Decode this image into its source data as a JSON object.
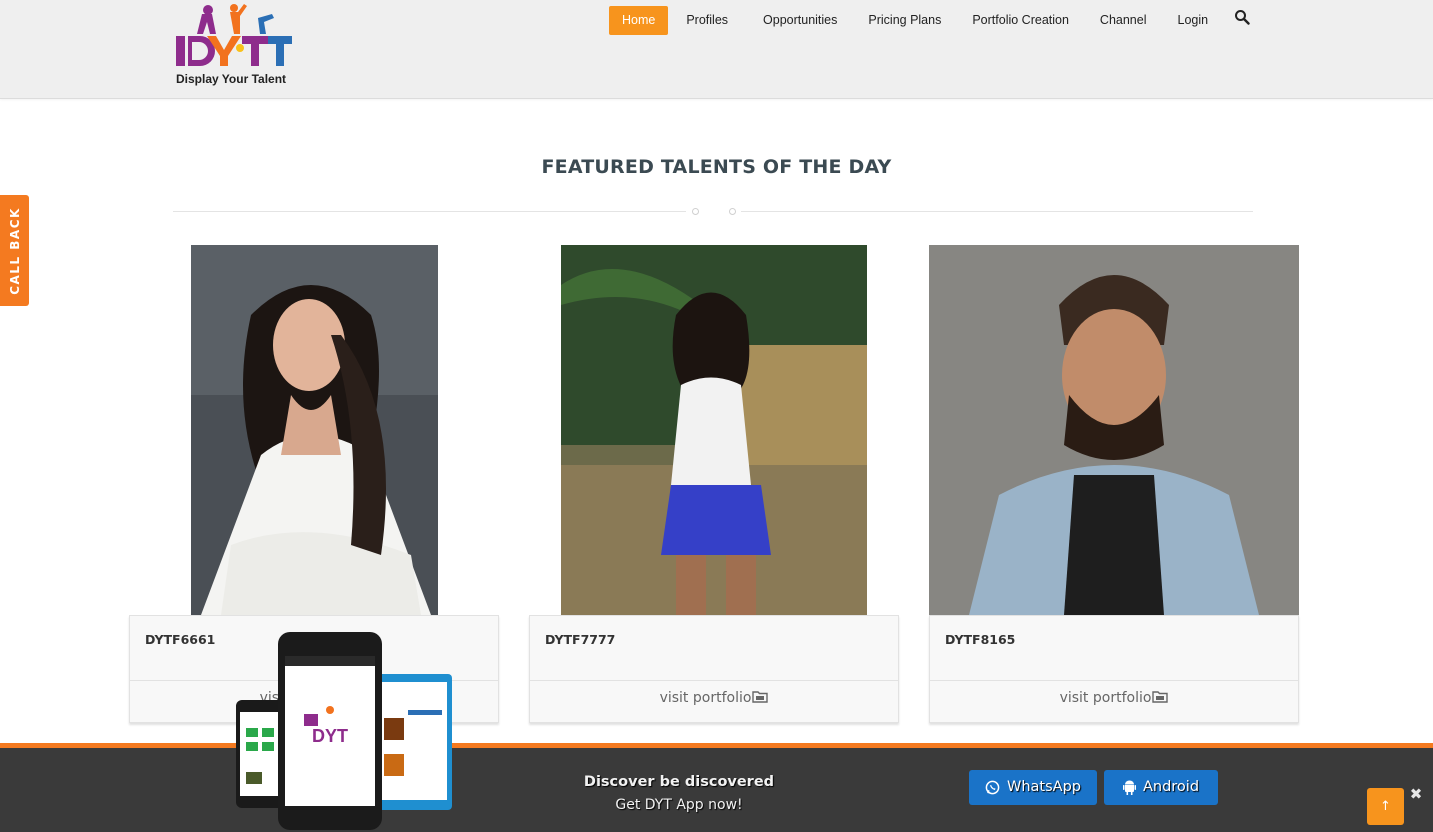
{
  "brand": {
    "logo_text": "Display Your Talent",
    "accent": "#f7941d"
  },
  "nav": {
    "items": [
      {
        "label": "Home",
        "active": true
      },
      {
        "label": "Profiles"
      },
      {
        "label": "Opportunities"
      },
      {
        "label": "Pricing Plans"
      },
      {
        "label": "Portfolio Creation"
      },
      {
        "label": "Channel"
      },
      {
        "label": "Login"
      }
    ],
    "search_icon": "search-icon"
  },
  "callback": {
    "label": "CALL BACK",
    "color": "#f47a20"
  },
  "featured": {
    "title": "FEATURED TALENTS OF THE DAY",
    "cards": [
      {
        "name": "DYTF6661",
        "link": "visit portfolio"
      },
      {
        "name": "DYTF7777",
        "link": "visit portfolio"
      },
      {
        "name": "DYTF8165",
        "link": "visit portfolio"
      }
    ]
  },
  "app_bar": {
    "headline": "Discover be discovered",
    "subline": "Get DYT App now!",
    "whatsapp_label": "WhatsApp",
    "android_label": "Android",
    "button_color": "#1a73c8",
    "scroll_top_icon": "arrow-up-icon",
    "close_icon": "close-icon"
  }
}
